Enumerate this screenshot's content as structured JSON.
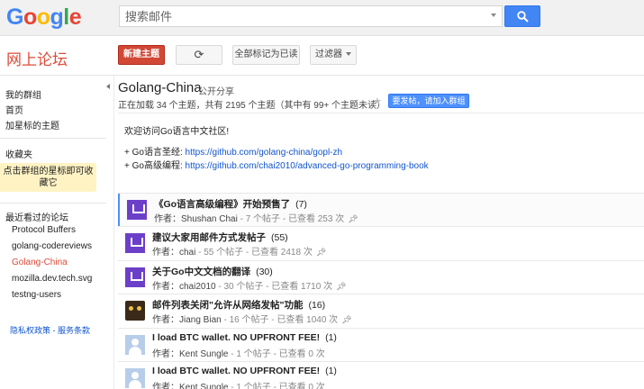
{
  "header": {
    "logo_letters": [
      {
        "ch": "G",
        "color": "#4285f4"
      },
      {
        "ch": "o",
        "color": "#ea4335"
      },
      {
        "ch": "o",
        "color": "#fbbc05"
      },
      {
        "ch": "g",
        "color": "#4285f4"
      },
      {
        "ch": "l",
        "color": "#34a853"
      },
      {
        "ch": "e",
        "color": "#ea4335"
      }
    ],
    "search_placeholder": "搜索邮件"
  },
  "appbar": {
    "title": "网上论坛",
    "new_topic": "新建主题",
    "refresh_icon": "⟳",
    "mark_all_read": "全部标记为已读",
    "filter": "过滤器"
  },
  "sidebar": {
    "my_groups": "我的群组",
    "home": "首页",
    "starred": "加星标的主题",
    "favorites": "收藏夹",
    "favorites_hint": "点击群组的星标即可收藏它",
    "recent": "最近看过的论坛",
    "recent_items": [
      "Protocol Buffers",
      "golang-codereviews",
      "Golang-China",
      "mozilla.dev.tech.svg",
      "testng-users"
    ],
    "footer": "隐私权政策 - 服务条款"
  },
  "group": {
    "name": "Golang-China",
    "share": "公开分享",
    "summary": "正在加载 34 个主题，共有 2195 个主题（其中有 99+ 个主题未读）",
    "join_button": "要发帖，请加入群组",
    "welcome": "欢迎访问Go语言中文社区!",
    "links": [
      {
        "label": "+ Go语言圣经: ",
        "url": "https://github.com/golang-china/gopl-zh"
      },
      {
        "label": "+ Go高级编程: ",
        "url": "https://github.com/chai2010/advanced-go-programming-book"
      }
    ]
  },
  "threads": [
    {
      "title": "《Go语言高级编程》开始预售了",
      "count": "(7)",
      "author_label": "作者：",
      "author": "Shushan Chai",
      "stats": " - 7 个帖子 - 已查看 253 次",
      "pinned": true,
      "avatar": "purple-logo-icon"
    },
    {
      "title": "建议大家用邮件方式发帖子",
      "count": "(55)",
      "author_label": "作者：",
      "author": "chai",
      "stats": " - 55 个帖子 - 已查看 2418 次",
      "pinned": true,
      "avatar": "purple-logo-icon"
    },
    {
      "title": "关于Go中文文档的翻译",
      "count": "(30)",
      "author_label": "作者：",
      "author": "chai2010",
      "stats": " - 30 个帖子 - 已查看 1710 次",
      "pinned": true,
      "avatar": "purple-logo-icon"
    },
    {
      "title": "邮件列表关闭\"允许从网络发帖\"功能",
      "count": "(16)",
      "author_label": "作者：",
      "author": "Jiang Bian",
      "stats": " - 16 个帖子 - 已查看 1040 次",
      "pinned": true,
      "avatar": "owl-icon"
    },
    {
      "title": "I load BTC wallet. NO UPFRONT FEE!",
      "count": "(1)",
      "author_label": "作者：",
      "author": "Kent Sungle",
      "stats": " - 1 个帖子 - 已查看 0 次",
      "pinned": false,
      "avatar": "person-icon"
    },
    {
      "title": "I load BTC wallet. NO UPFRONT FEE!",
      "count": "(1)",
      "author_label": "作者：",
      "author": "Kent Sungle",
      "stats": " - 1 个帖子 - 已查看 0 次",
      "pinned": false,
      "avatar": "person-icon"
    }
  ]
}
